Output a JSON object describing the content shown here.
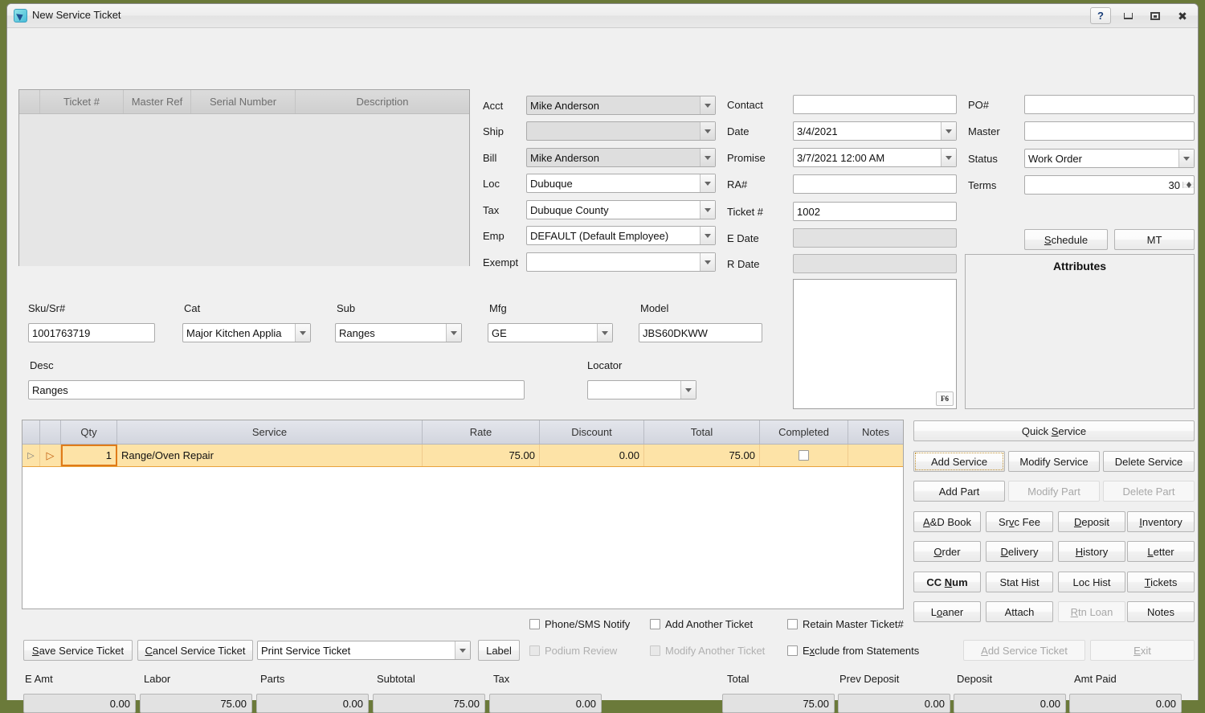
{
  "window": {
    "title": "New Service Ticket",
    "icon": "app-icon",
    "controls": {
      "help": "?",
      "minimize": "minimize",
      "maximize": "maximize",
      "close": "close"
    }
  },
  "ticket_grid": {
    "columns": [
      "",
      "Ticket #",
      "Master Ref",
      "Serial Number",
      "Description"
    ],
    "rows": []
  },
  "form": {
    "left": [
      {
        "label": "Acct",
        "value": "Mike Anderson",
        "type": "combo",
        "disabled": true
      },
      {
        "label": "Ship",
        "value": "",
        "type": "combo",
        "disabled": true
      },
      {
        "label": "Bill",
        "value": "Mike Anderson",
        "type": "combo",
        "disabled": true
      },
      {
        "label": "Loc",
        "value": "Dubuque",
        "type": "combo",
        "disabled": false
      },
      {
        "label": "Tax",
        "value": "Dubuque County",
        "type": "combo",
        "disabled": false
      },
      {
        "label": "Emp",
        "value": "DEFAULT (Default Employee)",
        "type": "combo",
        "disabled": false
      },
      {
        "label": "Exempt",
        "value": "",
        "type": "combo",
        "disabled": false
      }
    ],
    "middle": [
      {
        "label": "Contact",
        "value": "",
        "type": "text",
        "readonly": false
      },
      {
        "label": "Date",
        "value": "3/4/2021",
        "type": "combo",
        "readonly": false
      },
      {
        "label": "Promise",
        "value": "3/7/2021 12:00 AM",
        "type": "combo",
        "readonly": false
      },
      {
        "label": "RA#",
        "value": "",
        "type": "text",
        "readonly": false
      },
      {
        "label": "Ticket #",
        "value": "1002",
        "type": "text",
        "readonly": false
      },
      {
        "label": "E Date",
        "value": "",
        "type": "text",
        "readonly": true
      },
      {
        "label": "R Date",
        "value": "",
        "type": "text",
        "readonly": true
      }
    ],
    "right": [
      {
        "label": "PO#",
        "value": "",
        "type": "text"
      },
      {
        "label": "Master",
        "value": "",
        "type": "text"
      },
      {
        "label": "Status",
        "value": "Work Order",
        "type": "combo"
      },
      {
        "label": "Terms",
        "value": "30",
        "type": "spin"
      }
    ],
    "schedule_button": "Schedule",
    "schedule_accel": "S",
    "mt_button": "MT"
  },
  "attributes": {
    "title": "Attributes"
  },
  "notes_box": {
    "hotkey": "F6",
    "value": ""
  },
  "item": {
    "sku_label": "Sku/Sr#",
    "sku_value": "1001763719",
    "cat_label": "Cat",
    "cat_value": "Major Kitchen Applia",
    "sub_label": "Sub",
    "sub_value": "Ranges",
    "mfg_label": "Mfg",
    "mfg_value": "GE",
    "model_label": "Model",
    "model_value": "JBS60DKWW",
    "desc_label": "Desc",
    "desc_value": "Ranges",
    "locator_label": "Locator",
    "locator_value": ""
  },
  "service_grid": {
    "columns": [
      "",
      "",
      "Qty",
      "Service",
      "Rate",
      "Discount",
      "Total",
      "Completed",
      "Notes"
    ],
    "rows": [
      {
        "qty": "1",
        "service": "Range/Oven Repair",
        "rate": "75.00",
        "discount": "0.00",
        "total": "75.00",
        "completed": false,
        "notes": ""
      }
    ]
  },
  "action_buttons": {
    "quick_service": {
      "label": "Quick Service",
      "accel": "S",
      "disabled": false
    },
    "rows": [
      [
        {
          "label": "Add Service",
          "accel": "",
          "disabled": false,
          "focused": true
        },
        {
          "label": "Modify Service",
          "accel": "",
          "disabled": false
        },
        {
          "label": "Delete Service",
          "accel": "",
          "disabled": false
        }
      ],
      [
        {
          "label": "Add Part",
          "accel": "",
          "disabled": false
        },
        {
          "label": "Modify Part",
          "accel": "",
          "disabled": true
        },
        {
          "label": "Delete Part",
          "accel": "",
          "disabled": true
        }
      ]
    ],
    "grid": [
      [
        {
          "label": "A&D Book",
          "accel": "A",
          "disabled": false
        },
        {
          "label": "Srvc Fee",
          "accel": "v",
          "disabled": false
        },
        {
          "label": "Deposit",
          "accel": "D",
          "disabled": false
        },
        {
          "label": "Inventory",
          "accel": "I",
          "disabled": false
        }
      ],
      [
        {
          "label": "Order",
          "accel": "O",
          "disabled": false
        },
        {
          "label": "Delivery",
          "accel": "D",
          "disabled": false
        },
        {
          "label": "History",
          "accel": "H",
          "disabled": false
        },
        {
          "label": "Letter",
          "accel": "L",
          "disabled": false
        }
      ],
      [
        {
          "label": "CC Num",
          "accel": "N",
          "disabled": false,
          "bold": true
        },
        {
          "label": "Stat Hist",
          "accel": "",
          "disabled": false
        },
        {
          "label": "Loc Hist",
          "accel": "",
          "disabled": false
        },
        {
          "label": "Tickets",
          "accel": "T",
          "disabled": false
        }
      ],
      [
        {
          "label": "Loaner",
          "accel": "o",
          "disabled": false
        },
        {
          "label": "Attach",
          "accel": "",
          "disabled": false
        },
        {
          "label": "Rtn Loan",
          "accel": "R",
          "disabled": true
        },
        {
          "label": "Notes",
          "accel": "",
          "disabled": false
        }
      ]
    ]
  },
  "checkboxes": [
    {
      "label": "Phone/SMS Notify",
      "checked": false,
      "disabled": false
    },
    {
      "label": "Add Another Ticket",
      "checked": false,
      "disabled": false
    },
    {
      "label": "Retain Master Ticket#",
      "checked": false,
      "disabled": false
    },
    {
      "label": "Podium Review",
      "checked": false,
      "disabled": true
    },
    {
      "label": "Modify Another Ticket",
      "checked": false,
      "disabled": true
    },
    {
      "label": "Exclude from Statements",
      "checked": false,
      "disabled": false,
      "accel": "x"
    }
  ],
  "footer_buttons": {
    "save": {
      "label": "Save Service Ticket",
      "accel": "S"
    },
    "cancel": {
      "label": "Cancel Service Ticket",
      "accel": "C"
    },
    "print": {
      "label": "Print Service Ticket"
    },
    "label_btn": {
      "label": "Label"
    },
    "add_service_ticket": {
      "label": "Add Service Ticket",
      "accel": "A",
      "disabled": true
    },
    "exit": {
      "label": "Exit",
      "accel": "E",
      "disabled": true
    }
  },
  "totals": [
    {
      "label": "E Amt",
      "value": "0.00"
    },
    {
      "label": "Labor",
      "value": "75.00"
    },
    {
      "label": "Parts",
      "value": "0.00"
    },
    {
      "label": "Subtotal",
      "value": "75.00"
    },
    {
      "label": "Tax",
      "value": "0.00"
    },
    {
      "label": "Total",
      "value": "75.00"
    },
    {
      "label": "Prev Deposit",
      "value": "0.00"
    },
    {
      "label": "Deposit",
      "value": "0.00"
    },
    {
      "label": "Amt Paid",
      "value": "0.00"
    }
  ],
  "colors": {
    "row_highlight": "#fde3a7",
    "row_border": "#e8a33d",
    "window_bg": "#f0f0f0",
    "desktop": "#6b7a3a"
  }
}
